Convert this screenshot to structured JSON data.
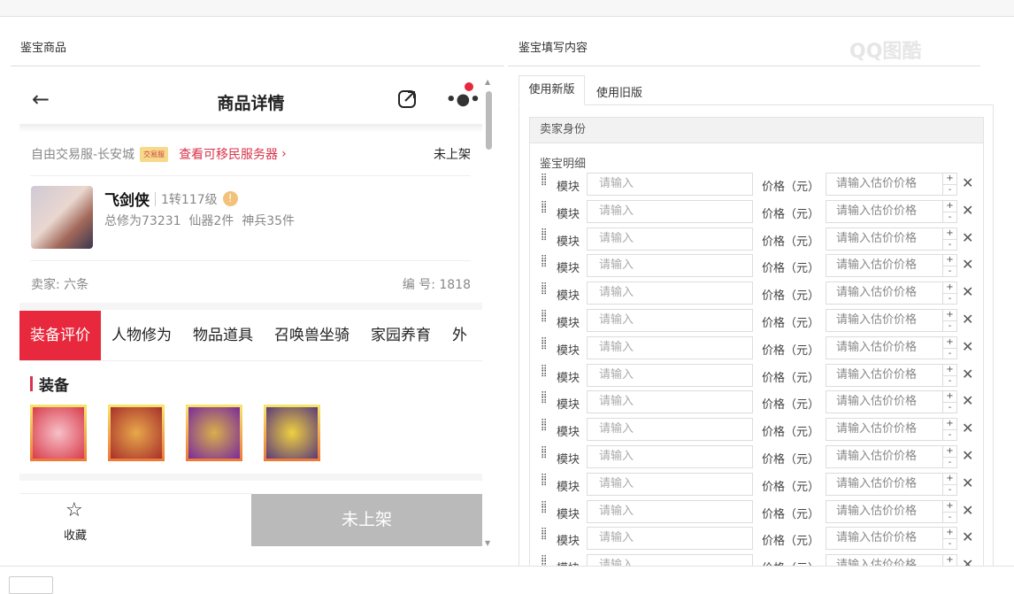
{
  "left": {
    "title": "鉴宝商品",
    "phone": {
      "header_title": "商品详情",
      "server": "自由交易服-长安城",
      "server_badge": "交易服",
      "migrate_link": "查看可移民服务器",
      "status": "未上架",
      "char_name": "飞剑侠",
      "char_level": "1转117级",
      "char_stats": "总修为73231  仙器2件  神兵35件",
      "seller": "卖家: 六条",
      "serial": "编 号: 1818",
      "tabs": [
        "装备评价",
        "人物修为",
        "物品道具",
        "召唤兽坐骑",
        "家园养育",
        "外"
      ],
      "section": "装备",
      "favorite": "收藏",
      "unlisted_button": "未上架"
    }
  },
  "right": {
    "title": "鉴宝填写内容",
    "watermark": "QQ图酷",
    "tabs": [
      "使用新版",
      "使用旧版"
    ],
    "seller_identity": "卖家身份",
    "detail_label": "鉴宝明细",
    "row_label": "模块",
    "row_placeholder": "请输入",
    "price_label": "价格（元）",
    "price_placeholder": "请输入估价价格",
    "row_count": 15
  },
  "colors": {
    "accent": "#e8283c"
  }
}
